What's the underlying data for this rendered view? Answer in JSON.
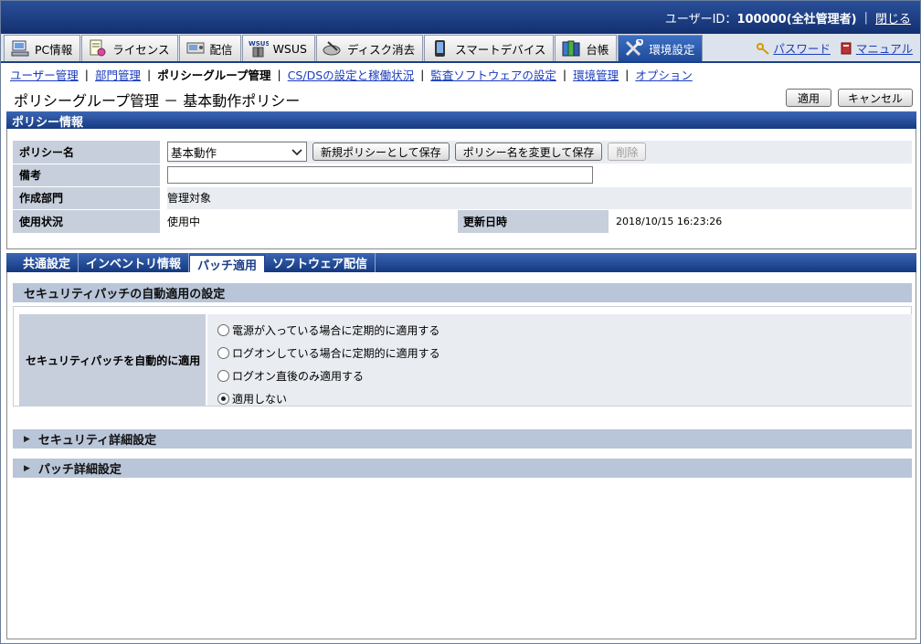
{
  "header": {
    "user_label": "ユーザーID：",
    "user_id": "100000(全社管理者)",
    "close_label": "閉じる"
  },
  "tabs": [
    {
      "label": "PC情報",
      "icon": "pc-info-icon"
    },
    {
      "label": "ライセンス",
      "icon": "license-icon"
    },
    {
      "label": "配信",
      "icon": "distribution-icon"
    },
    {
      "label": "WSUS",
      "icon": "wsus-icon",
      "icon_text": "WSUS"
    },
    {
      "label": "ディスク消去",
      "icon": "disk-erase-icon"
    },
    {
      "label": "スマートデバイス",
      "icon": "smart-device-icon"
    },
    {
      "label": "台帳",
      "icon": "ledger-icon"
    },
    {
      "label": "環境設定",
      "icon": "settings-tools-icon",
      "active": true
    }
  ],
  "right_links": {
    "password": "パスワード",
    "manual": "マニュアル"
  },
  "subnav": {
    "items": [
      "ユーザー管理",
      "部門管理",
      "ポリシーグループ管理",
      "CS/DSの設定と稼働状況",
      "監査ソフトウェアの設定",
      "環境管理",
      "オプション"
    ],
    "current_index": 2
  },
  "page": {
    "title": "ポリシーグループ管理 － 基本動作ポリシー",
    "apply_label": "適用",
    "cancel_label": "キャンセル"
  },
  "policy": {
    "section_title": "ポリシー情報",
    "name_label": "ポリシー名",
    "name_value": "基本動作",
    "save_new_label": "新規ポリシーとして保存",
    "rename_save_label": "ポリシー名を変更して保存",
    "delete_label": "削除",
    "memo_label": "備考",
    "memo_value": "",
    "dept_label": "作成部門",
    "dept_value": "管理対象",
    "status_label": "使用状況",
    "status_value": "使用中",
    "updated_label": "更新日時",
    "updated_value": "2018/10/15 16:23:26"
  },
  "policy_tabs": [
    {
      "label": "共通設定"
    },
    {
      "label": "インベントリ情報"
    },
    {
      "label": "パッチ適用",
      "active": true
    },
    {
      "label": "ソフトウェア配信"
    }
  ],
  "patch": {
    "section_title": "セキュリティパッチの自動適用の設定",
    "row_label": "セキュリティパッチを自動的に適用",
    "options": [
      "電源が入っている場合に定期的に適用する",
      "ログオンしている場合に定期的に適用する",
      "ログオン直後のみ適用する",
      "適用しない"
    ],
    "selected_index": 3
  },
  "collapsed_sections": {
    "security_detail": "セキュリティ詳細設定",
    "patch_detail": "パッチ詳細設定"
  }
}
